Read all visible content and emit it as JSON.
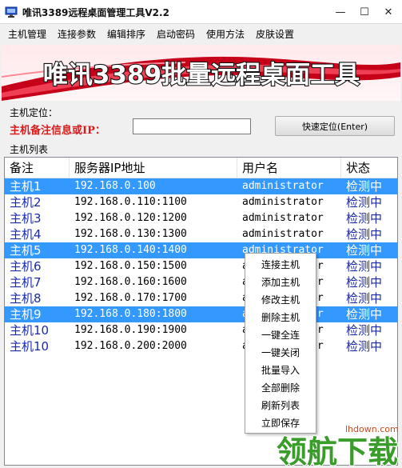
{
  "window": {
    "title": "唯讯3389远程桌面管理工具V2.2",
    "min_glyph": "—",
    "max_glyph": "☐",
    "close_glyph": "✕"
  },
  "menu": [
    "主机管理",
    "连接参数",
    "编辑排序",
    "启动密码",
    "使用方法",
    "皮肤设置"
  ],
  "banner": {
    "text": "唯讯3389批量远程桌面工具",
    "colors": {
      "base": "#c7001a",
      "highlight": "#ff5a6e",
      "text": "#ffffff",
      "outline": "#111111"
    }
  },
  "locate": {
    "group_caption": "主机定位：",
    "label": "主机备注信息或IP：",
    "input_value": "",
    "button_label": "快速定位(Enter)"
  },
  "host_list": {
    "caption": "主机列表",
    "columns": [
      "备注",
      "服务器IP地址",
      "用户名",
      "状态"
    ],
    "rows": [
      {
        "note": "主机1",
        "address": "192.168.0.100",
        "user": "administrator",
        "status": "检测中",
        "selected": true
      },
      {
        "note": "主机2",
        "address": "192.168.0.110:1100",
        "user": "administrator",
        "status": "检测中",
        "selected": false
      },
      {
        "note": "主机3",
        "address": "192.168.0.120:1200",
        "user": "administrator",
        "status": "检测中",
        "selected": false
      },
      {
        "note": "主机4",
        "address": "192.168.0.130:1300",
        "user": "administrator",
        "status": "检测中",
        "selected": false
      },
      {
        "note": "主机5",
        "address": "192.168.0.140:1400",
        "user": "administrator",
        "status": "检测中",
        "selected": true
      },
      {
        "note": "主机6",
        "address": "192.168.0.150:1500",
        "user": "administrator",
        "status": "检测中",
        "selected": false
      },
      {
        "note": "主机7",
        "address": "192.168.0.160:1600",
        "user": "administrator",
        "status": "检测中",
        "selected": false
      },
      {
        "note": "主机8",
        "address": "192.168.0.170:1700",
        "user": "administrator",
        "status": "检测中",
        "selected": false
      },
      {
        "note": "主机9",
        "address": "192.168.0.180:1800",
        "user": "administrator",
        "status": "检测中",
        "selected": true
      },
      {
        "note": "主机10",
        "address": "192.168.0.190:1900",
        "user": "administrator",
        "status": "检测中",
        "selected": false
      },
      {
        "note": "主机10",
        "address": "192.168.0.200:2000",
        "user": "administrator",
        "status": "检测中",
        "selected": false
      }
    ],
    "selected_color": "#3399ff",
    "note_color": "#1a2aa8"
  },
  "context_menu": [
    "连接主机",
    "添加主机",
    "修改主机",
    "删除主机",
    "一键全连",
    "一键关闭",
    "批量导入",
    "全部删除",
    "刷新列表",
    "立即保存"
  ],
  "watermark": {
    "url": "lhdown.com",
    "text": "领航下载",
    "color": "#3a9c2a"
  }
}
